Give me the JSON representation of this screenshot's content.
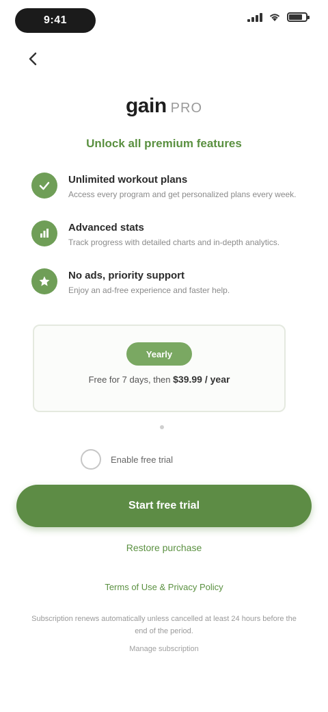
{
  "status_bar": {
    "time": "9:41"
  },
  "logo": {
    "word": "gain",
    "sub": "PRO"
  },
  "subtitle": "Unlock all premium features",
  "features": [
    {
      "icon": "check-icon",
      "title": "Unlimited workout plans",
      "desc": "Access every program and get personalized plans every week."
    },
    {
      "icon": "chart-icon",
      "title": "Advanced stats",
      "desc": "Track progress with detailed charts and in-depth analytics."
    },
    {
      "icon": "star-icon",
      "title": "No ads, priority support",
      "desc": "Enjoy an ad-free experience and faster help."
    }
  ],
  "plan": {
    "badge": "Yearly",
    "price_prefix": "Free for 7 days, then",
    "price": "$39.99 / year"
  },
  "checkbox": {
    "label": "Enable free trial"
  },
  "cta": {
    "label": "Start free trial"
  },
  "restore": "Restore purchase",
  "terms": "Terms of Use & Privacy Policy",
  "legal": "Subscription renews automatically unless cancelled at least 24 hours before the end of the period.",
  "footer": "Manage subscription",
  "colors": {
    "accent": "#5d8c45",
    "accent_light": "#7aa862"
  }
}
